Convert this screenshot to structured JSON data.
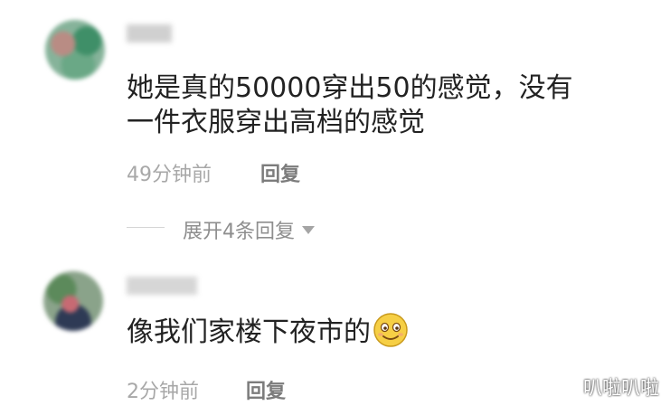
{
  "comments": [
    {
      "lines": [
        "她是真的50000穿出50的感觉，没有",
        "一件衣服穿出高档的感觉"
      ],
      "time": "49分钟前",
      "reply_label": "回复",
      "expand_label": "展开4条回复"
    },
    {
      "text": "像我们家楼下夜市的",
      "emoji": "smiling-face-emoji",
      "time": "2分钟前",
      "reply_label": "回复"
    }
  ],
  "watermark": "叭啦叭啦"
}
